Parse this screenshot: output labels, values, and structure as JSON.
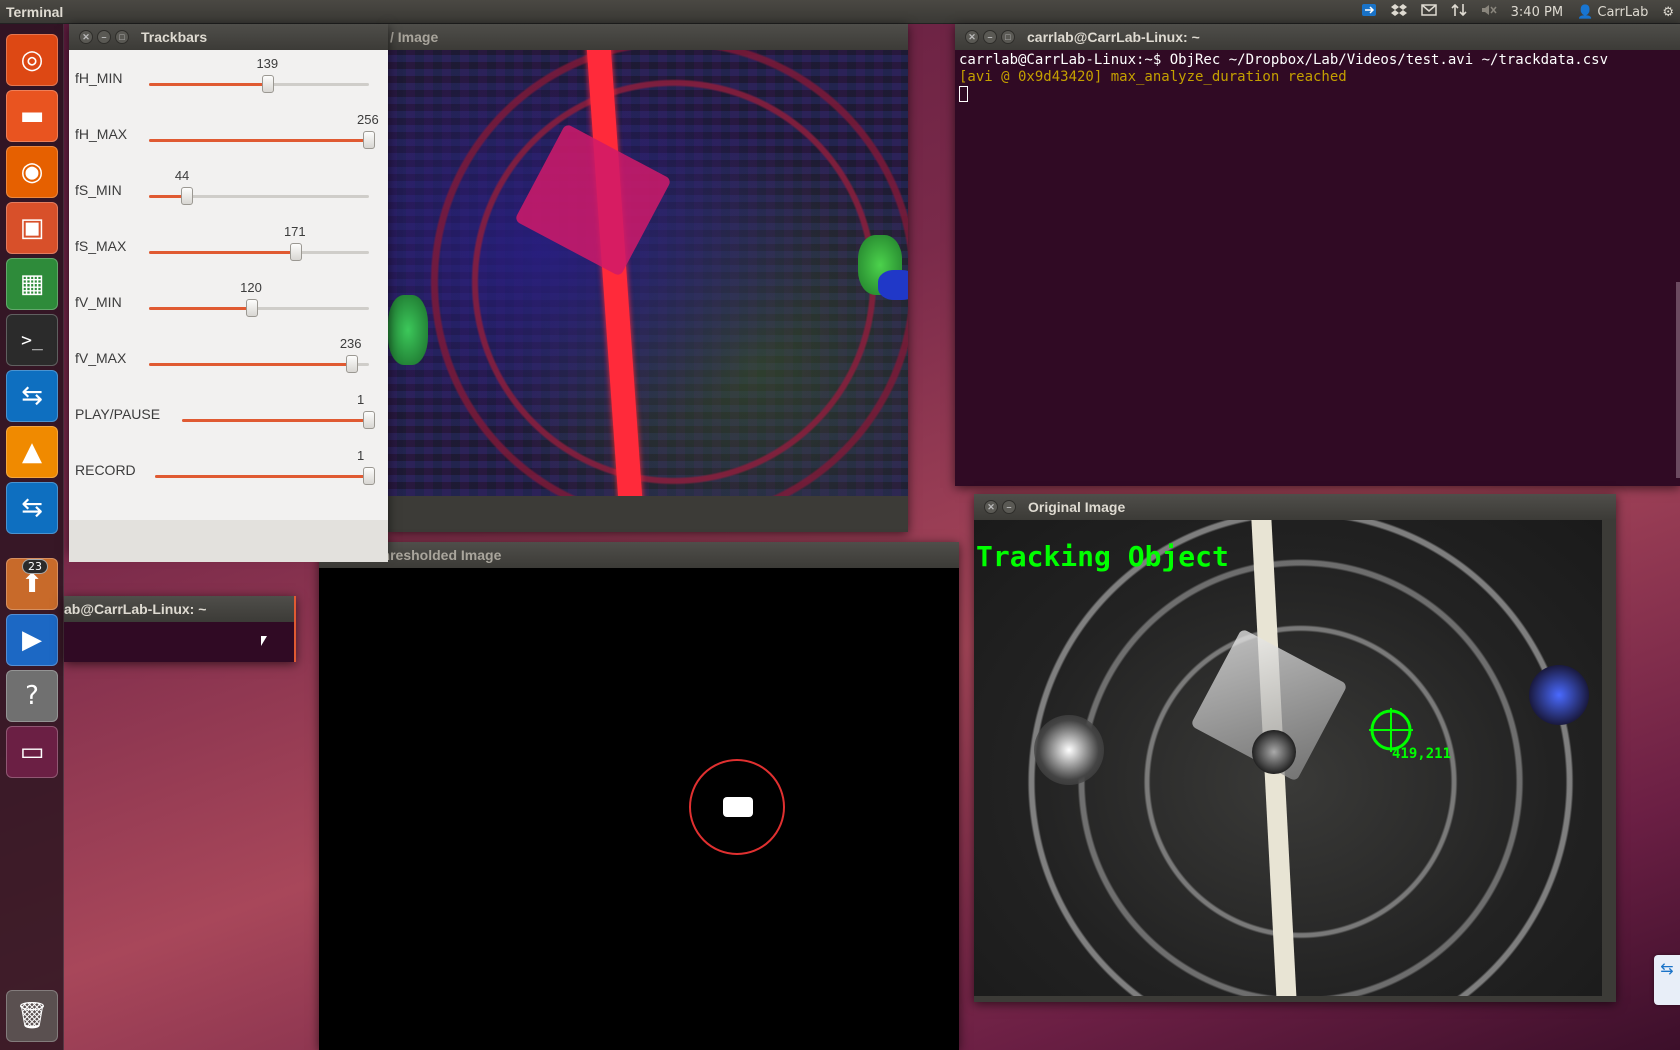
{
  "panel": {
    "app_title": "Terminal",
    "clock": "3:40 PM",
    "user": "CarrLab"
  },
  "launcher": {
    "items": [
      {
        "name": "ubuntu-dash-icon",
        "glyph": "◎",
        "color": "#dd4814"
      },
      {
        "name": "files-icon",
        "glyph": "▬",
        "color": "#e95420"
      },
      {
        "name": "firefox-icon",
        "glyph": "◉",
        "color": "#e66000"
      },
      {
        "name": "software-center-icon",
        "glyph": "▣",
        "color": "#d8502a"
      },
      {
        "name": "spreadsheet-icon",
        "glyph": "▦",
        "color": "#2e8b3a"
      },
      {
        "name": "terminal-icon",
        "glyph": ">_",
        "color": "#2b2b2b"
      },
      {
        "name": "teamviewer-icon",
        "glyph": "⇆",
        "color": "#0e6fc0"
      },
      {
        "name": "vlc-icon",
        "glyph": "▲",
        "color": "#f08a00"
      },
      {
        "name": "teamviewer-icon-2",
        "glyph": "⇆",
        "color": "#0e6fc0"
      },
      {
        "name": "update-manager-icon",
        "glyph": "⬆",
        "color": "#c86a2a"
      },
      {
        "name": "media-player-icon",
        "glyph": "▶",
        "color": "#1c68c4"
      },
      {
        "name": "help-icon",
        "glyph": "?",
        "color": "#707070"
      },
      {
        "name": "workspace-switcher-icon",
        "glyph": "▭",
        "color": "#6b1f44"
      }
    ],
    "update_badge": "23",
    "trash_glyph": "🗑"
  },
  "windows": {
    "trackbars": {
      "title": "Trackbars",
      "sliders": [
        {
          "label": "fH_MIN",
          "value": "139",
          "fraction": 0.543
        },
        {
          "label": "fH_MAX",
          "value": "256",
          "fraction": 1.0
        },
        {
          "label": "fS_MIN",
          "value": "44",
          "fraction": 0.172
        },
        {
          "label": "fS_MAX",
          "value": "171",
          "fraction": 0.668
        },
        {
          "label": "fV_MIN",
          "value": "120",
          "fraction": 0.469
        },
        {
          "label": "fV_MAX",
          "value": "236",
          "fraction": 0.922
        },
        {
          "label": "PLAY/PAUSE",
          "value": "1",
          "fraction": 1.0
        },
        {
          "label": "RECORD",
          "value": "1",
          "fraction": 1.0
        }
      ]
    },
    "hsv": {
      "title": "/ Image"
    },
    "terminal": {
      "title": "carrlab@CarrLab-Linux: ~",
      "line1": "carrlab@CarrLab-Linux:~$ ObjRec ~/Dropbox/Lab/Videos/test.avi ~/trackdata.csv",
      "line2": "[avi @ 0x9d43420] max_analyze_duration reached"
    },
    "small_terminal": {
      "title": "ab@CarrLab-Linux: ~"
    },
    "thresholded": {
      "title": "Thresholded Image"
    },
    "original": {
      "title": "Original Image",
      "overlay_text": "Tracking Object",
      "coords": "419,211"
    }
  },
  "colors": {
    "accent": "#e05a32",
    "tracking": "#00ff00",
    "terminal_bg": "#300a24",
    "threshold_circle": "#e03030"
  }
}
